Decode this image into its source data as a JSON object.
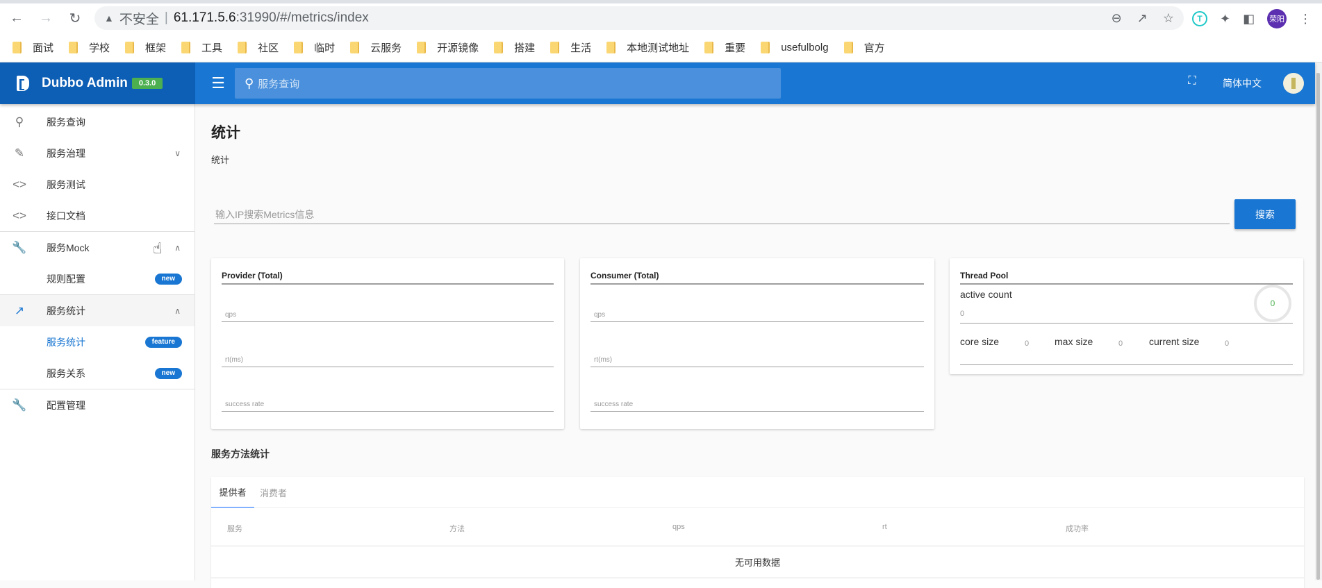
{
  "browser": {
    "insecure_label": "不安全",
    "url_host": "61.171.5.6",
    "url_rest": ":31990/#/metrics/index",
    "profile_name": "荣阳",
    "bookmarks": [
      "面试",
      "学校",
      "框架",
      "工具",
      "社区",
      "临时",
      "云服务",
      "开源镜像",
      "搭建",
      "生活",
      "本地测试地址",
      "重要",
      "usefulbolg",
      "官方"
    ]
  },
  "app": {
    "title": "Dubbo Admin",
    "version": "0.3.0",
    "search_placeholder": "服务查询",
    "language": "简体中文"
  },
  "sidebar": {
    "items": [
      {
        "label": "服务查询",
        "icon": "search-icon"
      },
      {
        "label": "服务治理",
        "icon": "pencil-icon",
        "expand": "down"
      },
      {
        "label": "服务测试",
        "icon": "code-icon"
      },
      {
        "label": "接口文档",
        "icon": "code-icon"
      },
      {
        "label": "服务Mock",
        "icon": "wrench-icon",
        "expand": "up"
      },
      {
        "label": "规则配置",
        "badge": "new"
      },
      {
        "label": "服务统计",
        "icon": "trending-icon",
        "expand": "up"
      },
      {
        "label": "服务统计",
        "badge": "feature",
        "selected": true
      },
      {
        "label": "服务关系",
        "badge": "new"
      },
      {
        "label": "配置管理",
        "icon": "wrench-icon"
      }
    ]
  },
  "page": {
    "title": "统计",
    "subtitle": "统计",
    "ip_placeholder": "输入IP搜索Metrics信息",
    "search_button": "搜索"
  },
  "provider_card": {
    "title": "Provider (Total)",
    "fields": [
      "qps",
      "rt(ms)",
      "success rate"
    ]
  },
  "consumer_card": {
    "title": "Consumer (Total)",
    "fields": [
      "qps",
      "rt(ms)",
      "success rate"
    ]
  },
  "thread_pool": {
    "title": "Thread Pool",
    "active_count_label": "active count",
    "active_count": "0",
    "gauge_value": "0",
    "core_size_label": "core size",
    "core_size": "0",
    "max_size_label": "max size",
    "max_size": "0",
    "current_size_label": "current size",
    "current_size": "0"
  },
  "method_stats": {
    "title": "服务方法统计",
    "tabs": [
      "提供者",
      "消费者"
    ],
    "active_tab": "提供者",
    "columns": [
      "服务",
      "方法",
      "qps",
      "rt",
      "成功率"
    ],
    "empty_text": "无可用数据"
  },
  "colors": {
    "primary": "#1976d2",
    "brand_dark": "#0d5eb5",
    "version_badge": "#4caf50"
  }
}
